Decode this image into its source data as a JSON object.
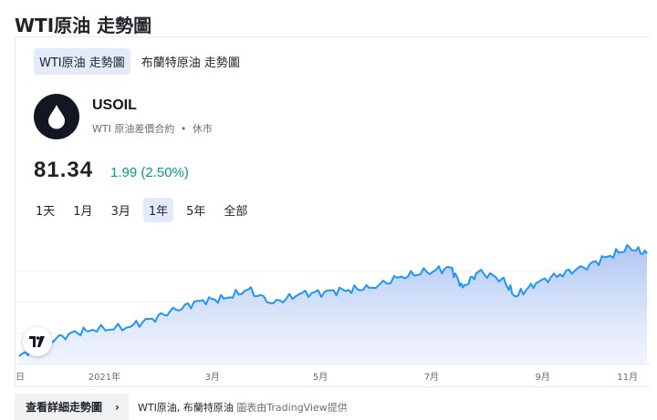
{
  "page": {
    "title": "WTI原油 走勢圖"
  },
  "tabs": [
    {
      "label": "WTI原油 走勢圖",
      "active": true
    },
    {
      "label": "布蘭特原油 走勢圖",
      "active": false
    }
  ],
  "instrument": {
    "logo_icon": "oil-drop-icon",
    "symbol": "USOIL",
    "description": "WTI 原油差價合約",
    "separator": "•",
    "status": "休市",
    "price": "81.34",
    "change": "1.99 (2.50%)",
    "change_color": "#089981"
  },
  "ranges": [
    {
      "label": "1天",
      "active": false
    },
    {
      "label": "1月",
      "active": false
    },
    {
      "label": "3月",
      "active": false
    },
    {
      "label": "1年",
      "active": true
    },
    {
      "label": "5年",
      "active": false
    },
    {
      "label": "全部",
      "active": false
    }
  ],
  "chart_data": {
    "type": "area",
    "series": [
      {
        "color": "#2196f3",
        "x": [
          "2020-11-02",
          "2020-11-16",
          "2020-12-01",
          "2020-12-15",
          "2021-01-04",
          "2021-01-19",
          "2021-02-02",
          "2021-02-16",
          "2021-03-02",
          "2021-03-16",
          "2021-03-31",
          "2021-04-15",
          "2021-04-30",
          "2021-05-14",
          "2021-05-28",
          "2021-06-14",
          "2021-06-29",
          "2021-07-13",
          "2021-07-20",
          "2021-07-29",
          "2021-08-12",
          "2021-08-20",
          "2021-09-01",
          "2021-09-15",
          "2021-09-29",
          "2021-10-13",
          "2021-10-26",
          "2021-11-05"
        ],
        "values": [
          35,
          41,
          45,
          47,
          48,
          52,
          56,
          60,
          61,
          65,
          59,
          63,
          64,
          65,
          66,
          71,
          73,
          75,
          66,
          73,
          70,
          62,
          68,
          72,
          75,
          80,
          84,
          81.34
        ]
      }
    ],
    "x_tick_labels": [
      "日",
      "2021年",
      "3月",
      "5月",
      "7月",
      "9月",
      "11月"
    ],
    "grid": true
  },
  "footer": {
    "more_button": "查看詳細走勢圖",
    "chevron_icon": "chevron-right-icon",
    "credit_links": "WTI原油, 布蘭特原油",
    "credit_text": "圖表由TradingView提供"
  }
}
